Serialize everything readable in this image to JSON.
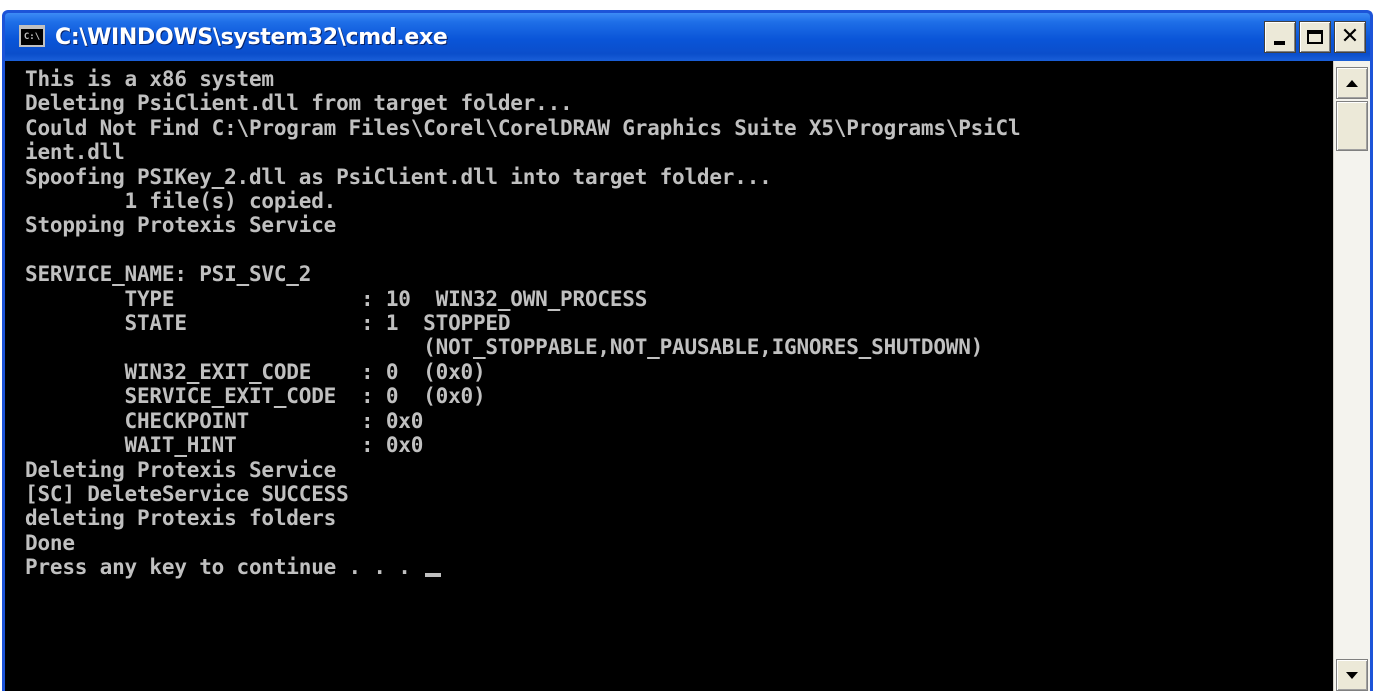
{
  "window": {
    "title": "C:\\WINDOWS\\system32\\cmd.exe",
    "icon_name": "cmd-app-icon",
    "icon_text": "C:\\",
    "buttons": {
      "minimize": "minimize-icon",
      "maximize": "maximize-icon",
      "close": "close-icon"
    }
  },
  "console": {
    "text_color": "#c0c0c0",
    "background_color": "#000000",
    "lines": [
      "This is a x86 system",
      "Deleting PsiClient.dll from target folder...",
      "Could Not Find C:\\Program Files\\Corel\\CorelDRAW Graphics Suite X5\\Programs\\PsiCl",
      "ient.dll",
      "Spoofing PSIKey_2.dll as PsiClient.dll into target folder...",
      "        1 file(s) copied.",
      "Stopping Protexis Service",
      "",
      "SERVICE_NAME: PSI_SVC_2",
      "        TYPE               : 10  WIN32_OWN_PROCESS",
      "        STATE              : 1  STOPPED",
      "                                (NOT_STOPPABLE,NOT_PAUSABLE,IGNORES_SHUTDOWN)",
      "        WIN32_EXIT_CODE    : 0  (0x0)",
      "        SERVICE_EXIT_CODE  : 0  (0x0)",
      "        CHECKPOINT         : 0x0",
      "        WAIT_HINT          : 0x0",
      "Deleting Protexis Service",
      "[SC] DeleteService SUCCESS",
      "deleting Protexis folders",
      "Done"
    ],
    "prompt": "Press any key to continue . . . "
  },
  "scrollbar": {
    "up": "scroll-up-arrow-icon",
    "down": "scroll-down-arrow-icon"
  }
}
